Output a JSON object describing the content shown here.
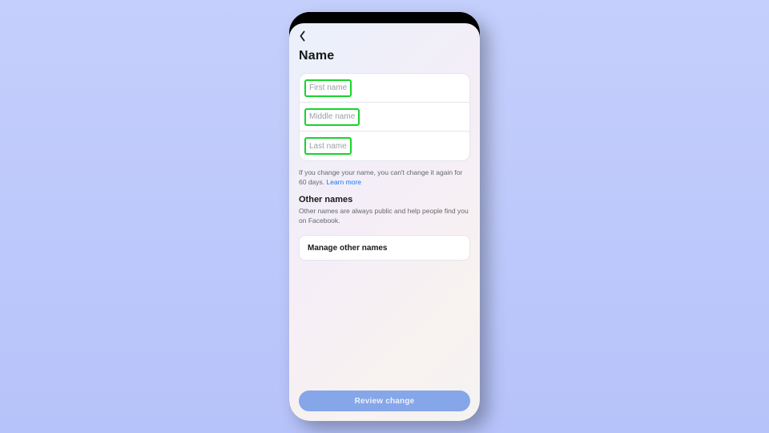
{
  "header": {
    "title": "Name"
  },
  "fields": {
    "first": {
      "placeholder": "First name",
      "value": ""
    },
    "middle": {
      "placeholder": "Middle name",
      "value": ""
    },
    "last": {
      "placeholder": "Last name",
      "value": ""
    }
  },
  "info": {
    "pre": "If you change your name, you can't change it again for 60 days. ",
    "link": "Learn more"
  },
  "other_names": {
    "title": "Other names",
    "desc": "Other names are always public and help people find you on Facebook.",
    "manage_label": "Manage other names"
  },
  "footer": {
    "review_label": "Review change"
  }
}
